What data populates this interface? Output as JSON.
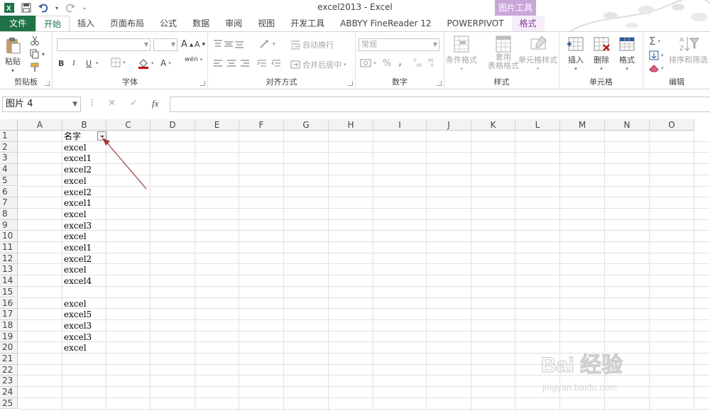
{
  "window": {
    "title": "excel2013 - Excel"
  },
  "contextual": {
    "picture_tools": "图片工具"
  },
  "tabs": [
    "文件",
    "开始",
    "插入",
    "页面布局",
    "公式",
    "数据",
    "审阅",
    "视图",
    "开发工具",
    "ABBYY FineReader 12",
    "POWERPIVOT",
    "格式"
  ],
  "ribbon": {
    "clipboard": {
      "paste": "粘贴",
      "label": "剪贴板"
    },
    "font": {
      "label": "字体",
      "bold": "B",
      "italic": "I",
      "underline": "U",
      "grow": "A",
      "shrink": "A",
      "phonetic": "wén"
    },
    "alignment": {
      "wrap": "自动换行",
      "merge": "合并后居中",
      "label": "对齐方式"
    },
    "number": {
      "format": "常规",
      "percent": "%",
      "comma": ",",
      "label": "数字"
    },
    "styles": {
      "conditional": "条件格式",
      "table_line1": "套用",
      "table_line2": "表格格式",
      "cell_styles": "单元格样式",
      "label": "样式"
    },
    "cells": {
      "insert": "插入",
      "delete": "删除",
      "format": "格式",
      "label": "单元格"
    },
    "editing": {
      "sort_filter": "排序和筛选",
      "label": "编辑"
    }
  },
  "formula_bar": {
    "name_box": "图片 4",
    "cancel": "✕",
    "enter": "✓",
    "fx": "fx",
    "value": ""
  },
  "columns": [
    "A",
    "B",
    "C",
    "D",
    "E",
    "F",
    "G",
    "H",
    "I",
    "J",
    "K",
    "L",
    "M",
    "N",
    "O"
  ],
  "rows": [
    "1",
    "2",
    "3",
    "4",
    "5",
    "6",
    "7",
    "8",
    "9",
    "10",
    "11",
    "12",
    "13",
    "14",
    "15",
    "16",
    "17",
    "18",
    "19",
    "20",
    "21",
    "22",
    "23",
    "24",
    "25"
  ],
  "column_b": [
    "名字",
    "excel",
    "excel1",
    "excel2",
    "excel",
    "excel2",
    "excel1",
    "excel",
    "excel3",
    "excel",
    "excel1",
    "excel2",
    "excel",
    "excel4",
    "",
    "excel",
    "excel5",
    "excel3",
    "excel3",
    "excel"
  ],
  "watermark": {
    "text": "Bai 经验",
    "url": "jingyan.baidu.com"
  },
  "colors": {
    "excel_green": "#217346",
    "picture_tools": "#c9a6d8",
    "arrow": "#a33a3a"
  }
}
